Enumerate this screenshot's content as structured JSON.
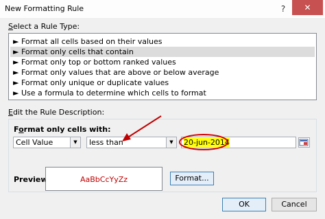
{
  "window": {
    "title": "New Formatting Rule",
    "help_glyph": "?",
    "close_glyph": "✕"
  },
  "rule_type": {
    "label_pre": "S",
    "label_post": "elect a Rule Type:",
    "items": [
      {
        "label": "► Format all cells based on their values",
        "selected": false
      },
      {
        "label": "► Format only cells that contain",
        "selected": true
      },
      {
        "label": "► Format only top or bottom ranked values",
        "selected": false
      },
      {
        "label": "► Format only values that are above or below average",
        "selected": false
      },
      {
        "label": "► Format only unique or duplicate values",
        "selected": false
      },
      {
        "label": "► Use a formula to determine which cells to format",
        "selected": false
      }
    ]
  },
  "description": {
    "label_pre": "E",
    "label_post": "dit the Rule Description:",
    "format_only_pre": "F",
    "format_only_mid": "o",
    "format_only_post": "rmat only cells with:",
    "cell_value_combo": "Cell Value",
    "operator_combo": "less than",
    "value_field": "20-jun-2014",
    "preview_label": "Preview:",
    "preview_sample": "AaBbCcYyZz",
    "format_button": "Format..."
  },
  "footer": {
    "ok_button": "OK",
    "cancel_button": "Cancel"
  },
  "annotation_colors": {
    "arrow": "#c00000",
    "circle": "#d40000"
  }
}
